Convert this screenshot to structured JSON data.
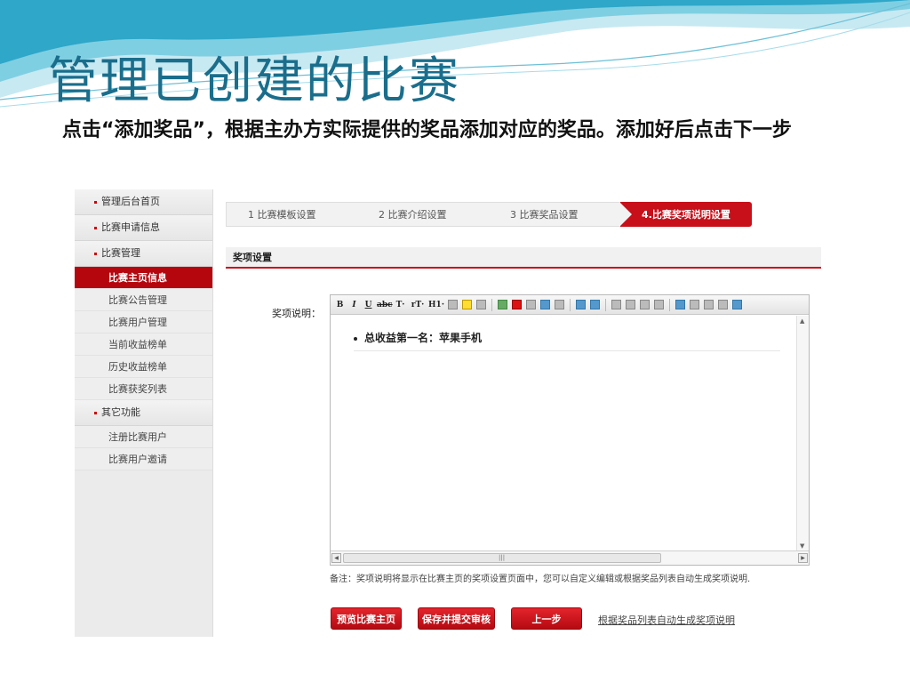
{
  "slide": {
    "title": "管理已创建的比赛",
    "instruction": "点击“添加奖品”，根据主办方实际提供的奖品添加对应的奖品。添加好后点击下一步"
  },
  "sidebar": {
    "groups": [
      {
        "label": "管理后台首页"
      },
      {
        "label": "比赛申请信息"
      },
      {
        "label": "比赛管理"
      },
      {
        "label": "其它功能"
      }
    ],
    "sub_items": [
      {
        "label": "比赛主页信息",
        "active": true
      },
      {
        "label": "比赛公告管理"
      },
      {
        "label": "比赛用户管理"
      },
      {
        "label": "当前收益榜单"
      },
      {
        "label": "历史收益榜单"
      },
      {
        "label": "比赛获奖列表"
      }
    ],
    "other_items": [
      {
        "label": "注册比赛用户"
      },
      {
        "label": "比赛用户邀请"
      }
    ]
  },
  "steps": [
    {
      "label": "1 比赛模板设置"
    },
    {
      "label": "2 比赛介绍设置"
    },
    {
      "label": "3 比赛奖品设置"
    },
    {
      "label": "4.比赛奖项说明设置",
      "active": true
    }
  ],
  "section": {
    "title": "奖项设置"
  },
  "form": {
    "field_label": "奖项说明：",
    "editor_content": "总收益第一名：苹果手机",
    "toolbar": [
      "B",
      "I",
      "U",
      "abc",
      "T·",
      "rT·",
      "H1·"
    ],
    "note": "备注：奖项说明将显示在比赛主页的奖项设置页面中，您可以自定义编辑或根据奖品列表自动生成奖项说明."
  },
  "buttons": {
    "preview": "预览比赛主页",
    "save_submit": "保存并提交审核",
    "prev_step": "上一步",
    "auto_generate": "根据奖品列表自动生成奖项说明"
  },
  "colors": {
    "accent_red": "#c8101a",
    "title_blue": "#1a6e8c"
  }
}
